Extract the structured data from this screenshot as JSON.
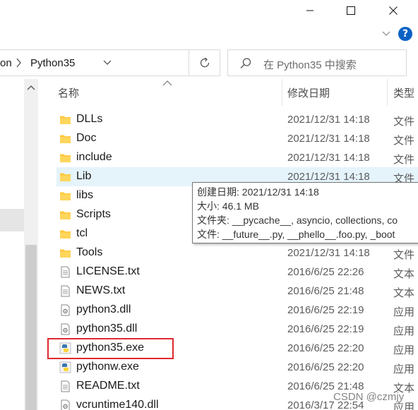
{
  "window": {
    "minimize_icon": "minimize-icon",
    "maximize_icon": "maximize-icon",
    "close_icon": "close-icon",
    "help_label": "?"
  },
  "address": {
    "previous_segment": "on",
    "current_folder": "Python35"
  },
  "search": {
    "placeholder": "在 Python35 中搜索"
  },
  "columns": {
    "name": "名称",
    "date": "修改日期",
    "type": "类型"
  },
  "files": [
    {
      "name": "DLLs",
      "date": "2021/12/31 14:18",
      "type": "文件",
      "icon": "folder-icon"
    },
    {
      "name": "Doc",
      "date": "2021/12/31 14:18",
      "type": "文件",
      "icon": "folder-icon"
    },
    {
      "name": "include",
      "date": "2021/12/31 14:18",
      "type": "文件",
      "icon": "folder-icon"
    },
    {
      "name": "Lib",
      "date": "2021/12/31 14:18",
      "type": "文件",
      "icon": "folder-icon"
    },
    {
      "name": "libs",
      "date": "",
      "type": "",
      "icon": "folder-icon"
    },
    {
      "name": "Scripts",
      "date": "",
      "type": "",
      "icon": "folder-icon"
    },
    {
      "name": "tcl",
      "date": "",
      "type": "",
      "icon": "folder-icon"
    },
    {
      "name": "Tools",
      "date": "2021/12/31 14:18",
      "type": "文件",
      "icon": "folder-icon"
    },
    {
      "name": "LICENSE.txt",
      "date": "2016/6/25 22:26",
      "type": "文本",
      "icon": "text-file-icon"
    },
    {
      "name": "NEWS.txt",
      "date": "2016/6/25 21:48",
      "type": "文本",
      "icon": "text-file-icon"
    },
    {
      "name": "python3.dll",
      "date": "2016/6/25 22:19",
      "type": "应用",
      "icon": "dll-file-icon"
    },
    {
      "name": "python35.dll",
      "date": "2016/6/25 22:19",
      "type": "应用",
      "icon": "dll-file-icon"
    },
    {
      "name": "python35.exe",
      "date": "2016/6/25 22:20",
      "type": "应用",
      "icon": "python-exe-icon"
    },
    {
      "name": "pythonw.exe",
      "date": "2016/6/25 22:20",
      "type": "应用",
      "icon": "python-exe-icon"
    },
    {
      "name": "README.txt",
      "date": "2016/6/25 21:48",
      "type": "文本",
      "icon": "text-file-icon"
    },
    {
      "name": "vcruntime140.dll",
      "date": "2016/3/17 22:54",
      "type": "应用",
      "icon": "dll-file-icon"
    }
  ],
  "tooltip": {
    "created": "创建日期: 2021/12/31 14:18",
    "size": "大小: 46.1 MB",
    "folders": "文件夹: __pycache__, asyncio, collections, co",
    "files": "文件: __future__.py, __phello__.foo.py, _boot"
  },
  "watermark": "CSDN @czmjy",
  "colors": {
    "hover_row": "#e5f3fb",
    "highlight_border": "#e0282e",
    "folder": "#ffc83d",
    "help_blue": "#0b62c4"
  }
}
